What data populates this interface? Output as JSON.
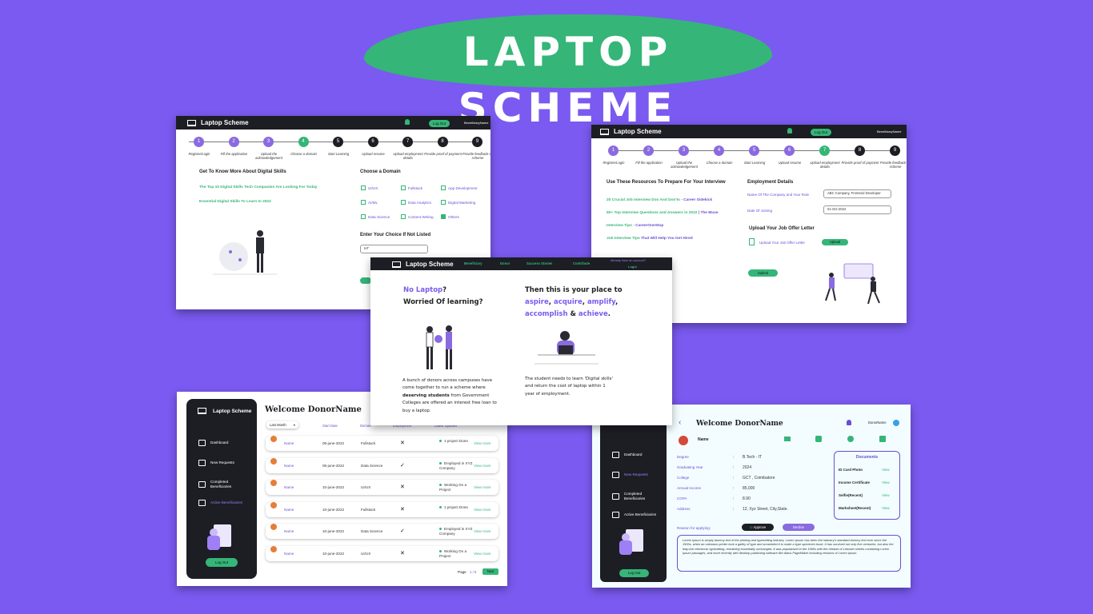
{
  "banner": {
    "title": "LAPTOP SCHEME"
  },
  "card1": {
    "brand": "Laptop Scheme",
    "logout": "Log Out",
    "user": "BeneficiaryName",
    "steps": [
      {
        "n": "1",
        "label": "Register/Login",
        "state": "p"
      },
      {
        "n": "2",
        "label": "Fill the application",
        "state": "p"
      },
      {
        "n": "3",
        "label": "Upload the acknowledgement",
        "state": "p"
      },
      {
        "n": "4",
        "label": "Choose a domain",
        "state": "g"
      },
      {
        "n": "5",
        "label": "Start Learning",
        "state": "k"
      },
      {
        "n": "6",
        "label": "Upload resume",
        "state": "k"
      },
      {
        "n": "7",
        "label": "Upload employment details",
        "state": "k"
      },
      {
        "n": "8",
        "label": "Provide proof of payment",
        "state": "k"
      },
      {
        "n": "9",
        "label": "Provide feedback on scheme",
        "state": "k"
      }
    ],
    "know_more_title": "Get To Know More About Digital Skills",
    "link1": "The Top 10 Digital Skills Tech Companies Are Looking For Today",
    "link2": "Essential Digital Skills To Learn In 2022",
    "domain_title": "Choose a Domain",
    "domains": [
      {
        "label": "UI/UX",
        "checked": false
      },
      {
        "label": "Fullstack",
        "checked": false
      },
      {
        "label": "App Development",
        "checked": false
      },
      {
        "label": "AI/ML",
        "checked": false
      },
      {
        "label": "Data Analytics",
        "checked": false
      },
      {
        "label": "Digital Marketing",
        "checked": false
      },
      {
        "label": "Data Science",
        "checked": false
      },
      {
        "label": "Content Writing",
        "checked": false
      },
      {
        "label": "Others",
        "checked": true
      }
    ],
    "choice_title": "Enter Your Choice If Not Listed",
    "choice_value": "IoT"
  },
  "card2": {
    "brand": "Laptop Scheme",
    "logout": "Log Out",
    "user": "BeneficiaryName",
    "steps": [
      {
        "n": "1",
        "label": "Register/Login",
        "state": "p"
      },
      {
        "n": "2",
        "label": "Fill the application",
        "state": "p"
      },
      {
        "n": "3",
        "label": "Upload the acknowledgement",
        "state": "p"
      },
      {
        "n": "4",
        "label": "Choose a domain",
        "state": "p"
      },
      {
        "n": "5",
        "label": "Start Learning",
        "state": "p"
      },
      {
        "n": "6",
        "label": "Upload resume",
        "state": "p"
      },
      {
        "n": "7",
        "label": "Upload employment details",
        "state": "g"
      },
      {
        "n": "8",
        "label": "Provide proof of payment",
        "state": "k"
      },
      {
        "n": "9",
        "label": "Provide feedback on scheme",
        "state": "k"
      }
    ],
    "resources_title": "Use These Resources To Prepare For Your Interview",
    "resources": [
      {
        "a": "20 Crucial Job Interview Dos And Don'ts",
        "b": " - Career Sidekick"
      },
      {
        "a": "50+ Top Interview Questions and Answers in 2022",
        "b": " | The Muse"
      },
      {
        "a": "Interview Tips",
        "b": " - CareerOneStop"
      },
      {
        "a": "Job Interview Tips",
        "b": " That Will Help You Get Hired"
      }
    ],
    "employment_title": "Employment Details",
    "company_label": "Name Of The Company and Your Role",
    "company_value": "ABC Company, Frontend Developer",
    "doj_label": "Date Of Joining",
    "doj_value": "01-Oct-2022",
    "upload_title": "Upload Your Job Offer Letter",
    "upload_label": "Upload Your Job Offer Letter",
    "upload_btn": "Upload",
    "submit": "Submit"
  },
  "card3": {
    "brand": "Laptop Scheme",
    "nav": [
      "Beneficiary",
      "Donor",
      "Success Stories",
      "Contribute"
    ],
    "account_q": "Already have an account?",
    "login": "Login",
    "left_l1a": "No Laptop",
    "left_l1b": "?",
    "left_l2": "Worried Of learning?",
    "right_l1": "Then this is your place to",
    "right_w1": "aspire",
    "right_w2": "acquire",
    "right_w3": "amplify",
    "right_w4": "accomplish",
    "right_amp": "&",
    "right_w5": "achieve",
    "left_p1": "A bunch of donors across campuses have",
    "left_p2": "come together to run a scheme where",
    "left_p3a": "deserving students",
    "left_p3b": " from Government",
    "left_p4": "Colleges are offered an interest free loan to",
    "left_p5": "buy a laptop.",
    "right_p1": "The student needs to learn 'Digital skills'",
    "right_p2": "and return the cost of laptop  within 1",
    "right_p3": "year of employment."
  },
  "card4": {
    "brand": "Laptop Scheme",
    "welcome": "Welcome DonorName",
    "sidebar": [
      "Dashboard",
      "New Requests",
      "Completed Beneficiaries",
      "Active Beneficiaries"
    ],
    "logout": "Log Out",
    "filter": "Last Month",
    "headers": [
      "Start Date",
      "Domain",
      "Employment",
      "Latest Updates"
    ],
    "rows": [
      {
        "name": "Name",
        "date": "06-june-2022",
        "domain": "Fullstack",
        "emp": "✕",
        "update": "1 project Done",
        "action": "View more"
      },
      {
        "name": "Name",
        "date": "06-june-2022",
        "domain": "Data Science",
        "emp": "✓",
        "update": "Employed in XYZ Company",
        "action": "View more"
      },
      {
        "name": "Name",
        "date": "10-june-2022",
        "domain": "UI/UX",
        "emp": "✕",
        "update": "Working On a Project",
        "action": "View more"
      },
      {
        "name": "Name",
        "date": "10-june-2022",
        "domain": "Fullstack",
        "emp": "✕",
        "update": "1 project Done",
        "action": "View more"
      },
      {
        "name": "Name",
        "date": "10-june-2022",
        "domain": "Data Science",
        "emp": "✓",
        "update": "Employed in XYZ Company",
        "action": "View more"
      },
      {
        "name": "Name",
        "date": "10-june-2022",
        "domain": "UI/UX",
        "emp": "✕",
        "update": "Working On a Project",
        "action": "View more"
      }
    ],
    "page_label": "Page",
    "page_value": "1 / 5",
    "next": "Next"
  },
  "card5": {
    "welcome": "Welcome DonorName",
    "user": "DonorName",
    "name": "Name",
    "sidebar": [
      "Dashboard",
      "New Requests",
      "Completed Beneficiaries",
      "Active Beneficiaries"
    ],
    "logout": "Log Out",
    "fields": [
      {
        "label": "Degree",
        "value": "B.Tech - IT"
      },
      {
        "label": "Graduating Year",
        "value": "2024"
      },
      {
        "label": "College",
        "value": "GCT , Coimbatore"
      },
      {
        "label": "Annual Income",
        "value": "85,000"
      },
      {
        "label": "CGPA",
        "value": "8.90"
      },
      {
        "label": "Address",
        "value": "12, Xyz Street, City,State."
      }
    ],
    "documents_title": "Documents",
    "documents": [
      {
        "label": "ID Card Photo",
        "action": "View"
      },
      {
        "label": "Income Certificate",
        "action": "View"
      },
      {
        "label": "Selfie(Recent)",
        "action": "View"
      },
      {
        "label": "Marksheet(Recent)",
        "action": "View"
      }
    ],
    "reason_label": "Reason for applying:",
    "approve": "Approve",
    "decline": "Decline",
    "reason_text": "Lorem Ipsum is simply dummy text of the printing and typesetting industry. Lorem Ipsum has been the industry's standard dummy text ever since the 1500s, when an unknown printer took a galley of type and scrambled it to make a type specimen book. It has survived not only five centuries, but also the leap into electronic typesetting, remaining essentially unchanged. It was popularised in the 1960s with the release of Letraset sheets containing Lorem Ipsum passages, and more recently with desktop publishing software like Aldus PageMaker including versions of Lorem Ipsum."
  }
}
